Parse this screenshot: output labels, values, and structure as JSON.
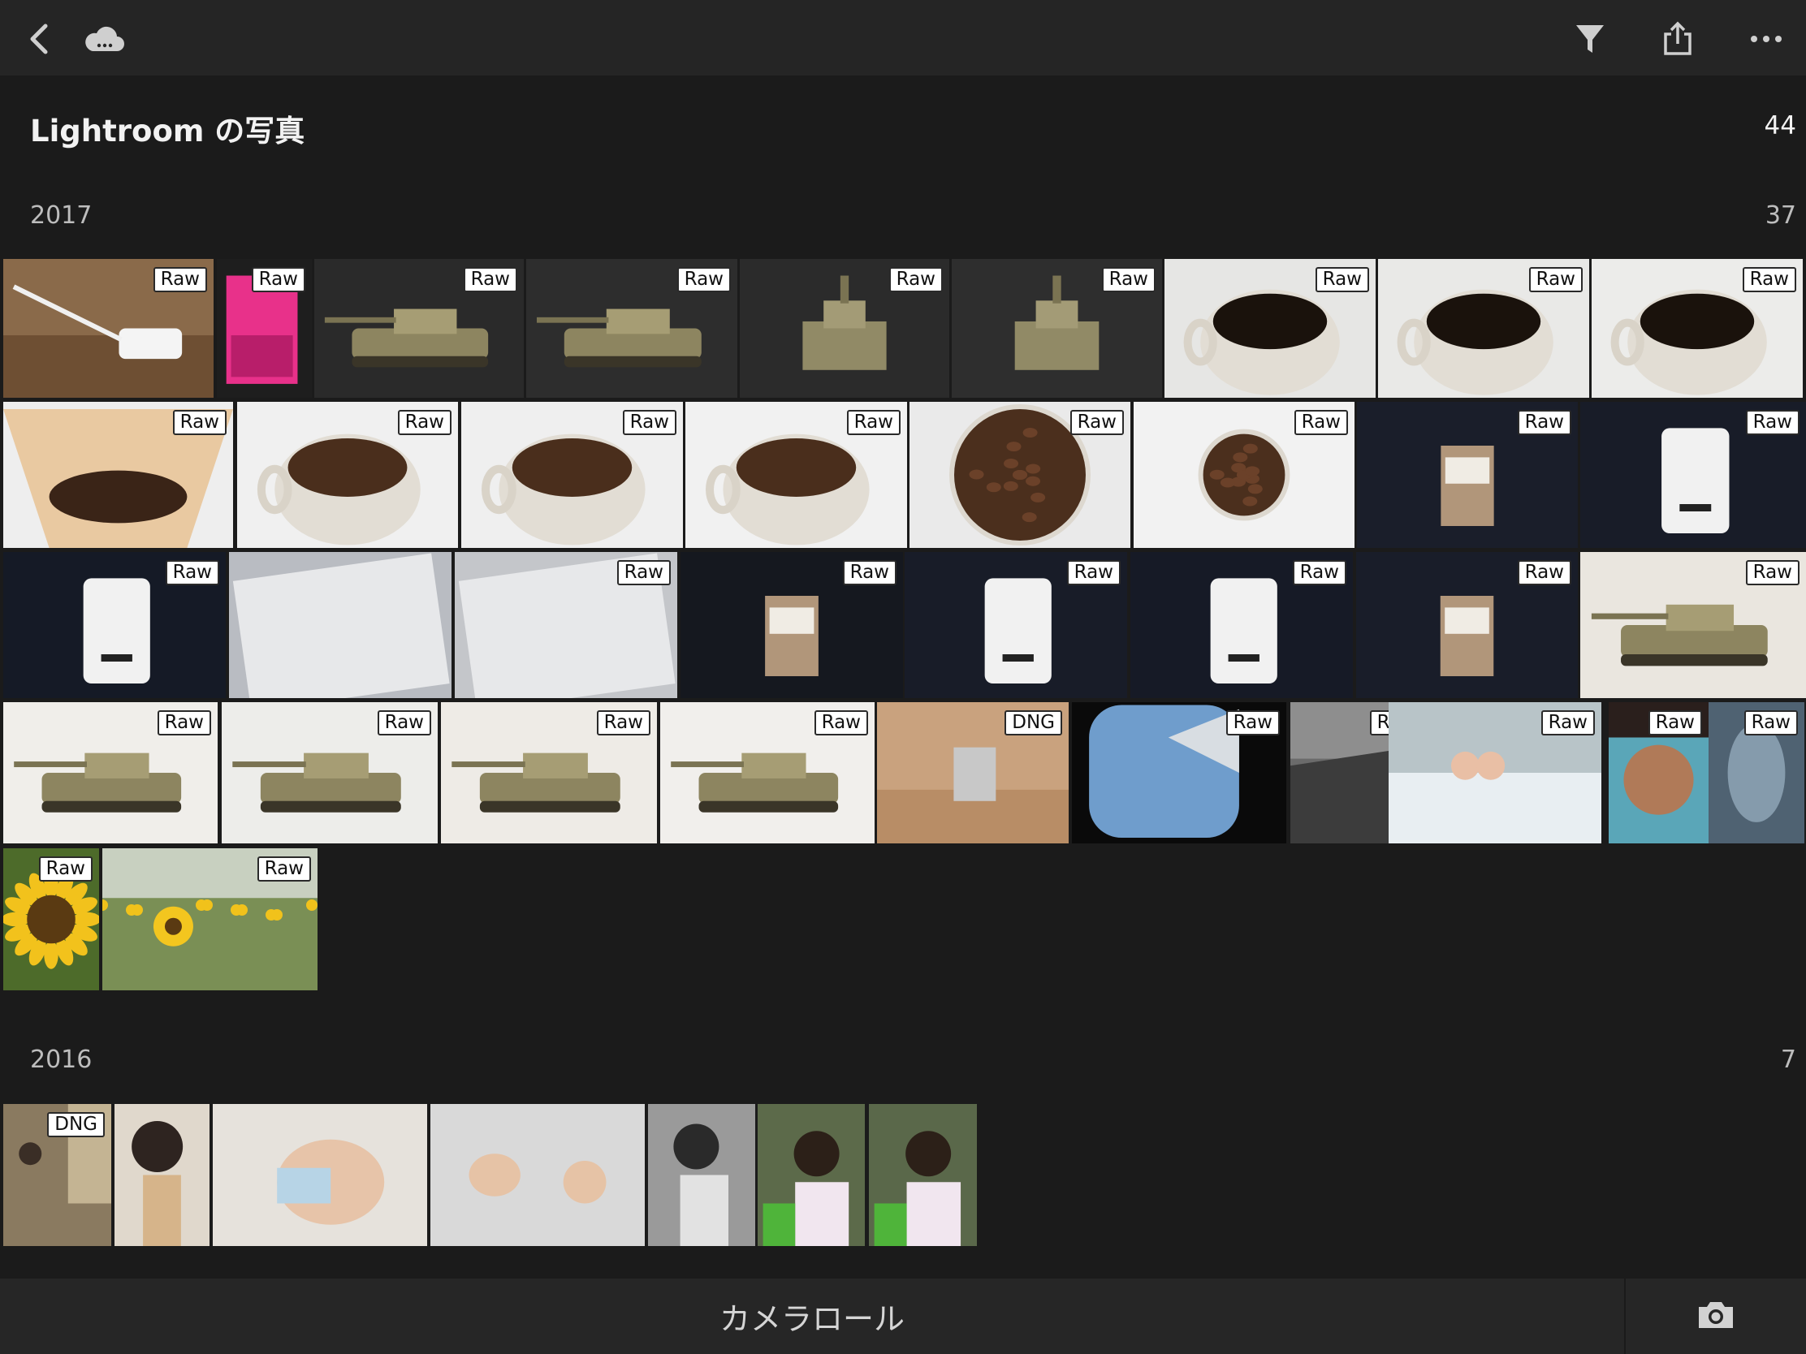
{
  "topbar": {
    "back_icon": "chevron-left-icon",
    "cloud_icon": "cloud-icon",
    "filter_icon": "filter-icon",
    "share_icon": "share-icon",
    "more_icon": "more-icon"
  },
  "album": {
    "title": "Lightroom の写真",
    "count": "44"
  },
  "sections": [
    {
      "year": "2017",
      "count": "37",
      "photos": [
        {
          "badge": "Raw",
          "subject": "adapter",
          "bg": "#8a6a4a"
        },
        {
          "badge": "Raw",
          "subject": "poster",
          "bg": "#1e1e1e"
        },
        {
          "badge": "Raw",
          "subject": "tank-side",
          "bg": "#2a2a2a"
        },
        {
          "badge": "Raw",
          "subject": "tank-side",
          "bg": "#2d2d2d"
        },
        {
          "badge": "Raw",
          "subject": "tank-front",
          "bg": "#2b2b2b"
        },
        {
          "badge": "Raw",
          "subject": "tank-front",
          "bg": "#2e2e2e"
        },
        {
          "badge": "Raw",
          "subject": "coffee-cup",
          "bg": "#e6e6e4"
        },
        {
          "badge": "Raw",
          "subject": "coffee-cup",
          "bg": "#e9e9e7"
        },
        {
          "badge": "Raw",
          "subject": "coffee-cup",
          "bg": "#ececea"
        },
        {
          "badge": "Raw",
          "subject": "filter-grounds",
          "bg": "#eeeeee"
        },
        {
          "badge": "Raw",
          "subject": "beans-cup",
          "bg": "#f0f0f0"
        },
        {
          "badge": "Raw",
          "subject": "beans-cup",
          "bg": "#efefef"
        },
        {
          "badge": "Raw",
          "subject": "beans-cup",
          "bg": "#f1f1f1"
        },
        {
          "badge": "Raw",
          "subject": "beans-top",
          "bg": "#eaeaea"
        },
        {
          "badge": "Raw",
          "subject": "beans-small",
          "bg": "#f2f2f2"
        },
        {
          "badge": "Raw",
          "subject": "bag-kraft",
          "bg": "#1a1e2a"
        },
        {
          "badge": "Raw",
          "subject": "bag-white",
          "bg": "#181c28"
        },
        {
          "badge": "Raw",
          "subject": "bag-white",
          "bg": "#151a26"
        },
        {
          "badge": "",
          "subject": "bag-closeup",
          "bg": "#b9bcc2"
        },
        {
          "badge": "Raw",
          "subject": "bag-closeup-no1",
          "bg": "#c4c6ca"
        },
        {
          "badge": "Raw",
          "subject": "bag-kraft-closeup",
          "bg": "#15181f"
        },
        {
          "badge": "Raw",
          "subject": "bag-white",
          "bg": "#181c28"
        },
        {
          "badge": "Raw",
          "subject": "bag-white",
          "bg": "#161a26"
        },
        {
          "badge": "Raw",
          "subject": "bag-kraft",
          "bg": "#191d29"
        },
        {
          "badge": "Raw",
          "subject": "tank-large",
          "bg": "#eae6df"
        },
        {
          "badge": "Raw",
          "subject": "tank-large",
          "bg": "#f0eeea"
        },
        {
          "badge": "Raw",
          "subject": "tank-large",
          "bg": "#ededea"
        },
        {
          "badge": "Raw",
          "subject": "tank-large",
          "bg": "#eeebe6"
        },
        {
          "badge": "Raw",
          "subject": "tank-large",
          "bg": "#f1efec"
        },
        {
          "badge": "DNG",
          "subject": "package-table",
          "bg": "#c9a27e"
        },
        {
          "badge": "Raw",
          "subject": "airplane-window",
          "bg": "#0a0a0a"
        },
        {
          "badge": "Raw",
          "subject": "wing-bw",
          "bg": "#6b6b6b"
        },
        {
          "badge": "Raw",
          "subject": "kids-ride",
          "bg": "#b8c4c8"
        },
        {
          "badge": "Raw",
          "subject": "kid-face",
          "bg": "#5aa6b8"
        },
        {
          "badge": "Raw",
          "subject": "aquarium",
          "bg": "#5b6e7c"
        },
        {
          "badge": "Raw",
          "subject": "sunflower",
          "bg": "#4d6b2a"
        },
        {
          "badge": "Raw",
          "subject": "sunflower-field",
          "bg": "#7a8f55"
        }
      ]
    },
    {
      "year": "2016",
      "count": "7",
      "photos": [
        {
          "badge": "DNG",
          "subject": "room-kids",
          "bg": "#8a7a60"
        },
        {
          "badge": "",
          "subject": "child-sleep",
          "bg": "#e0d8cc"
        },
        {
          "badge": "",
          "subject": "child-fever",
          "bg": "#e6e2dc"
        },
        {
          "badge": "",
          "subject": "baby-bed",
          "bg": "#d9d9d9"
        },
        {
          "badge": "",
          "subject": "child-bw",
          "bg": "#9a9a9a"
        },
        {
          "badge": "",
          "subject": "child-eat",
          "bg": "#5c6a4a"
        },
        {
          "badge": "",
          "subject": "child-eat",
          "bg": "#5a684a"
        }
      ]
    }
  ],
  "bottombar": {
    "camera_roll_label": "カメラロール",
    "camera_icon": "camera-icon"
  }
}
